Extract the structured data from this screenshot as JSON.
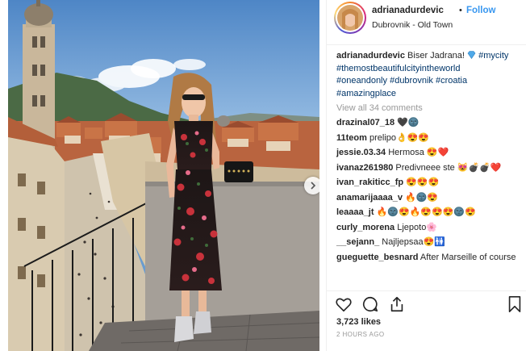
{
  "post": {
    "username": "adrianadurdevic",
    "follow_label": "Follow",
    "dot": "•",
    "location": "Dubrovnik - Old Town"
  },
  "caption": {
    "username": "adrianadurdevic",
    "text": "Biser Jadrana!",
    "tags": [
      "#mycity",
      "#themostbeautifulcityintheworld",
      "#oneandonly",
      "#dubrovnik",
      "#croatia",
      "#amazingplace"
    ]
  },
  "view_all_label": "View all 34 comments",
  "comments": [
    {
      "user": "drazinal07_18",
      "text": "🖤🌚"
    },
    {
      "user": "11teom",
      "text": "prelipo👌😍😍"
    },
    {
      "user": "jessie.03.34",
      "text": "Hermosa 😍❤️"
    },
    {
      "user": "ivanaz261980",
      "text": "Predivneee ste 😻💣💣❤️"
    },
    {
      "user": "ivan_rakiticc_fp",
      "text": "😍😍😍"
    },
    {
      "user": "anamarijaaaa_v",
      "text": "🔥🌚😍"
    },
    {
      "user": "leaaaa_jt",
      "text": "🔥🌚😍🔥😍😍😍🌚😍"
    },
    {
      "user": "curly_morena",
      "text": "Ljepoto🌸"
    },
    {
      "user": "__sejann_",
      "text": "Najljepsaa😍🚻"
    },
    {
      "user": "gueguette_besnard",
      "text": "After Marseille of course"
    }
  ],
  "likes": "3,723 likes",
  "time": "2 HOURS AGO",
  "colors": {
    "link": "#003569",
    "follow": "#3897f0",
    "muted": "#999999",
    "text": "#262626"
  },
  "icons": [
    "heart-icon",
    "comment-icon",
    "share-icon",
    "bookmark-icon",
    "chevron-right-icon",
    "verified-gem-icon"
  ]
}
